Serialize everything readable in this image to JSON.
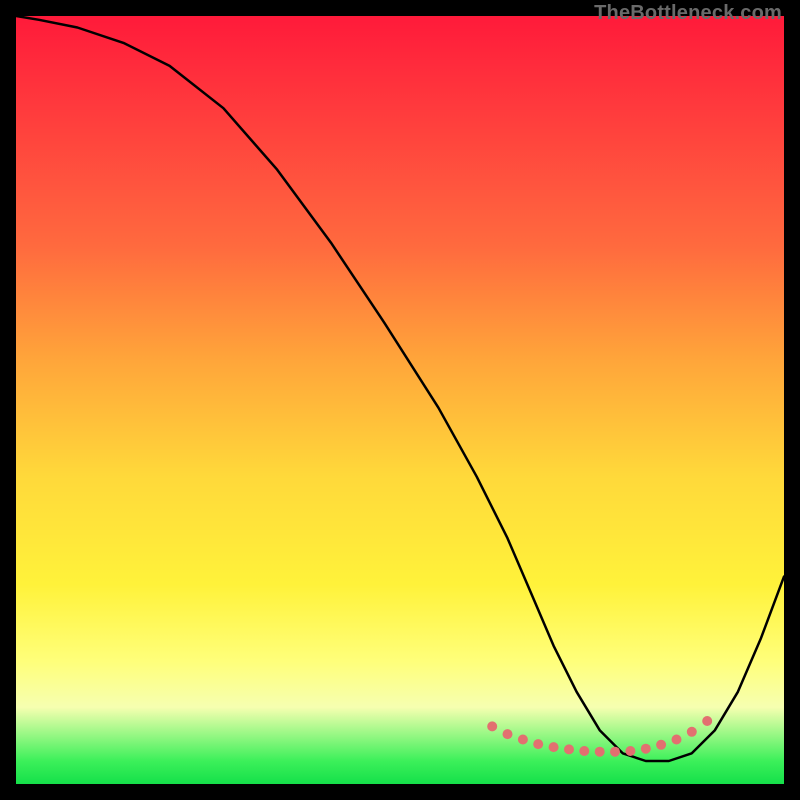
{
  "attribution": "TheBottleneck.com",
  "chart_data": {
    "type": "line",
    "title": "",
    "xlabel": "",
    "ylabel": "",
    "xlim": [
      0,
      100
    ],
    "ylim": [
      0,
      100
    ],
    "series": [
      {
        "name": "bottleneck-curve",
        "x": [
          0,
          3,
          8,
          14,
          20,
          27,
          34,
          41,
          48,
          55,
          60,
          64,
          67,
          70,
          73,
          76,
          79,
          82,
          85,
          88,
          91,
          94,
          97,
          100
        ],
        "y": [
          100,
          99.5,
          98.5,
          96.5,
          93.5,
          88,
          80,
          70.5,
          60,
          49,
          40,
          32,
          25,
          18,
          12,
          7,
          4,
          3,
          3,
          4,
          7,
          12,
          19,
          27
        ]
      }
    ],
    "markers": {
      "name": "trough-markers",
      "style": "dot",
      "color": "#e27070",
      "x": [
        62,
        64,
        66,
        68,
        70,
        72,
        74,
        76,
        78,
        80,
        82,
        84,
        86,
        88,
        90
      ],
      "y": [
        7.5,
        6.5,
        5.8,
        5.2,
        4.8,
        4.5,
        4.3,
        4.2,
        4.2,
        4.3,
        4.6,
        5.1,
        5.8,
        6.8,
        8.2
      ]
    },
    "gradient_stops": [
      {
        "pos": 0.0,
        "color": "#ff1a3a"
      },
      {
        "pos": 0.12,
        "color": "#ff3a3d"
      },
      {
        "pos": 0.3,
        "color": "#ff6a3e"
      },
      {
        "pos": 0.45,
        "color": "#ffa63a"
      },
      {
        "pos": 0.6,
        "color": "#ffd93a"
      },
      {
        "pos": 0.74,
        "color": "#fff23a"
      },
      {
        "pos": 0.84,
        "color": "#ffff7a"
      },
      {
        "pos": 0.9,
        "color": "#f6ffb0"
      },
      {
        "pos": 0.97,
        "color": "#3cf05a"
      },
      {
        "pos": 1.0,
        "color": "#15e04a"
      }
    ]
  }
}
